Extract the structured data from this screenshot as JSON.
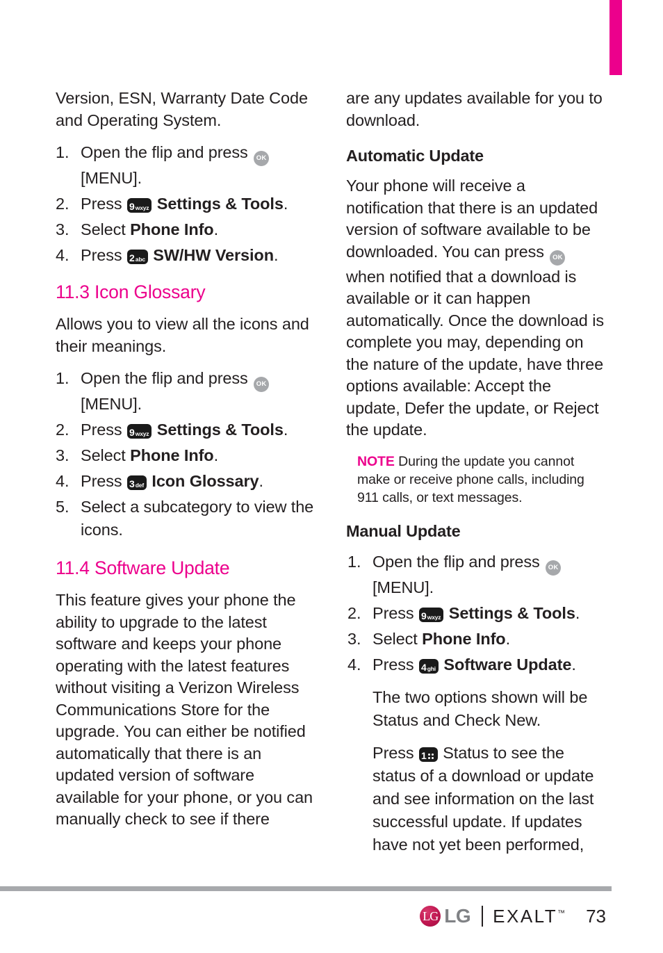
{
  "page": {
    "number": "73",
    "accent_color": "#ec008c",
    "tab_marker_color": "#ec008c",
    "text_color": "#231f20"
  },
  "footer": {
    "brand": "LG",
    "product": "EXALT",
    "trademark": "™",
    "page_number": "73",
    "lg_mark_glyph": "LG"
  },
  "left_column": {
    "intro_paragraph": "Version, ESN, Warranty Date Code and Operating System.",
    "sw_hw_steps": [
      {
        "pre": "Open the flip and press ",
        "key": "ok",
        "post": " [MENU]."
      },
      {
        "pre": "Press ",
        "key": "9wxyz",
        "post": "",
        "bold": "Settings & Tools",
        "tail": "."
      },
      {
        "pre": "Select ",
        "key": null,
        "post": "",
        "bold": "Phone Info",
        "tail": "."
      },
      {
        "pre": "Press ",
        "key": "2abc",
        "post": "",
        "bold": "SW/HW Version",
        "tail": "."
      }
    ],
    "section_11_3": {
      "heading": "11.3 Icon Glossary",
      "paragraph": "Allows you to view all the icons and their meanings.",
      "steps": [
        {
          "pre": "Open the flip and press ",
          "key": "ok",
          "post": " [MENU]."
        },
        {
          "pre": "Press ",
          "key": "9wxyz",
          "bold": "Settings & Tools",
          "tail": "."
        },
        {
          "pre": "Select ",
          "key": null,
          "bold": "Phone Info",
          "tail": "."
        },
        {
          "pre": "Press ",
          "key": "3def",
          "bold": "Icon Glossary",
          "tail": "."
        },
        {
          "pre": "Select a subcategory to view the icons.",
          "key": null,
          "bold": "",
          "tail": ""
        }
      ]
    },
    "section_11_4": {
      "heading": "11.4 Software Update",
      "paragraph": "This feature gives your phone the ability to upgrade to the latest software and keeps your phone operating with the latest features without visiting a Verizon Wireless Communications Store for the upgrade. You can either be notified automatically that there is an updated version of software available for your phone, or you can manually check to see if there"
    }
  },
  "right_column": {
    "continued_paragraph": "are any updates available for you to download.",
    "automatic_update": {
      "heading": "Automatic Update",
      "paragraph_part1": "Your phone will receive a notification that there is an updated version of software available to be downloaded. You can press ",
      "key": "ok",
      "paragraph_part2": " when notified that a download is available or it can happen automatically. Once the download is complete you may, depending on the nature of the update, have three options available: Accept the update, Defer the update, or Reject the update."
    },
    "note": {
      "label": "NOTE",
      "text": " During the update you cannot make or receive phone calls, including 911 calls, or text messages."
    },
    "manual_update": {
      "heading": "Manual Update",
      "steps": [
        {
          "pre": "Open the flip and press ",
          "key": "ok",
          "post": " [MENU]."
        },
        {
          "pre": "Press ",
          "key": "9wxyz",
          "bold": "Settings & Tools",
          "tail": "."
        },
        {
          "pre": "Select ",
          "key": null,
          "bold": "Phone Info",
          "tail": "."
        },
        {
          "pre": "Press ",
          "key": "4ghi",
          "bold": "Software Update",
          "tail": "."
        }
      ],
      "substep_1": "The two options shown will be Status and Check New.",
      "substep_2_part1": "Press ",
      "substep_2_key": "1",
      "substep_2_part2": " Status to see the status of a download or update and see information on the last successful update. If updates have not yet been performed,"
    }
  },
  "keys": {
    "ok": {
      "label": "OK",
      "type": "ok-circle"
    },
    "k1": {
      "digit": "1",
      "letters": ""
    },
    "k2": {
      "digit": "2",
      "letters": "abc"
    },
    "k3": {
      "digit": "3",
      "letters": "def"
    },
    "k4": {
      "digit": "4",
      "letters": "ghi"
    },
    "k9": {
      "digit": "9",
      "letters": "wxyz"
    }
  },
  "labels": {
    "menu_bracket": "[MENU].",
    "open_flip_press": "Open the flip and press ",
    "press": "Press ",
    "select": "Select ",
    "settings_tools": "Settings & Tools",
    "phone_info": "Phone Info",
    "sw_hw_version": "SW/HW Version",
    "icon_glossary": "Icon Glossary",
    "software_update": "Software Update",
    "select_subcategory": "Select a subcategory to view the icons.",
    "period": "."
  }
}
